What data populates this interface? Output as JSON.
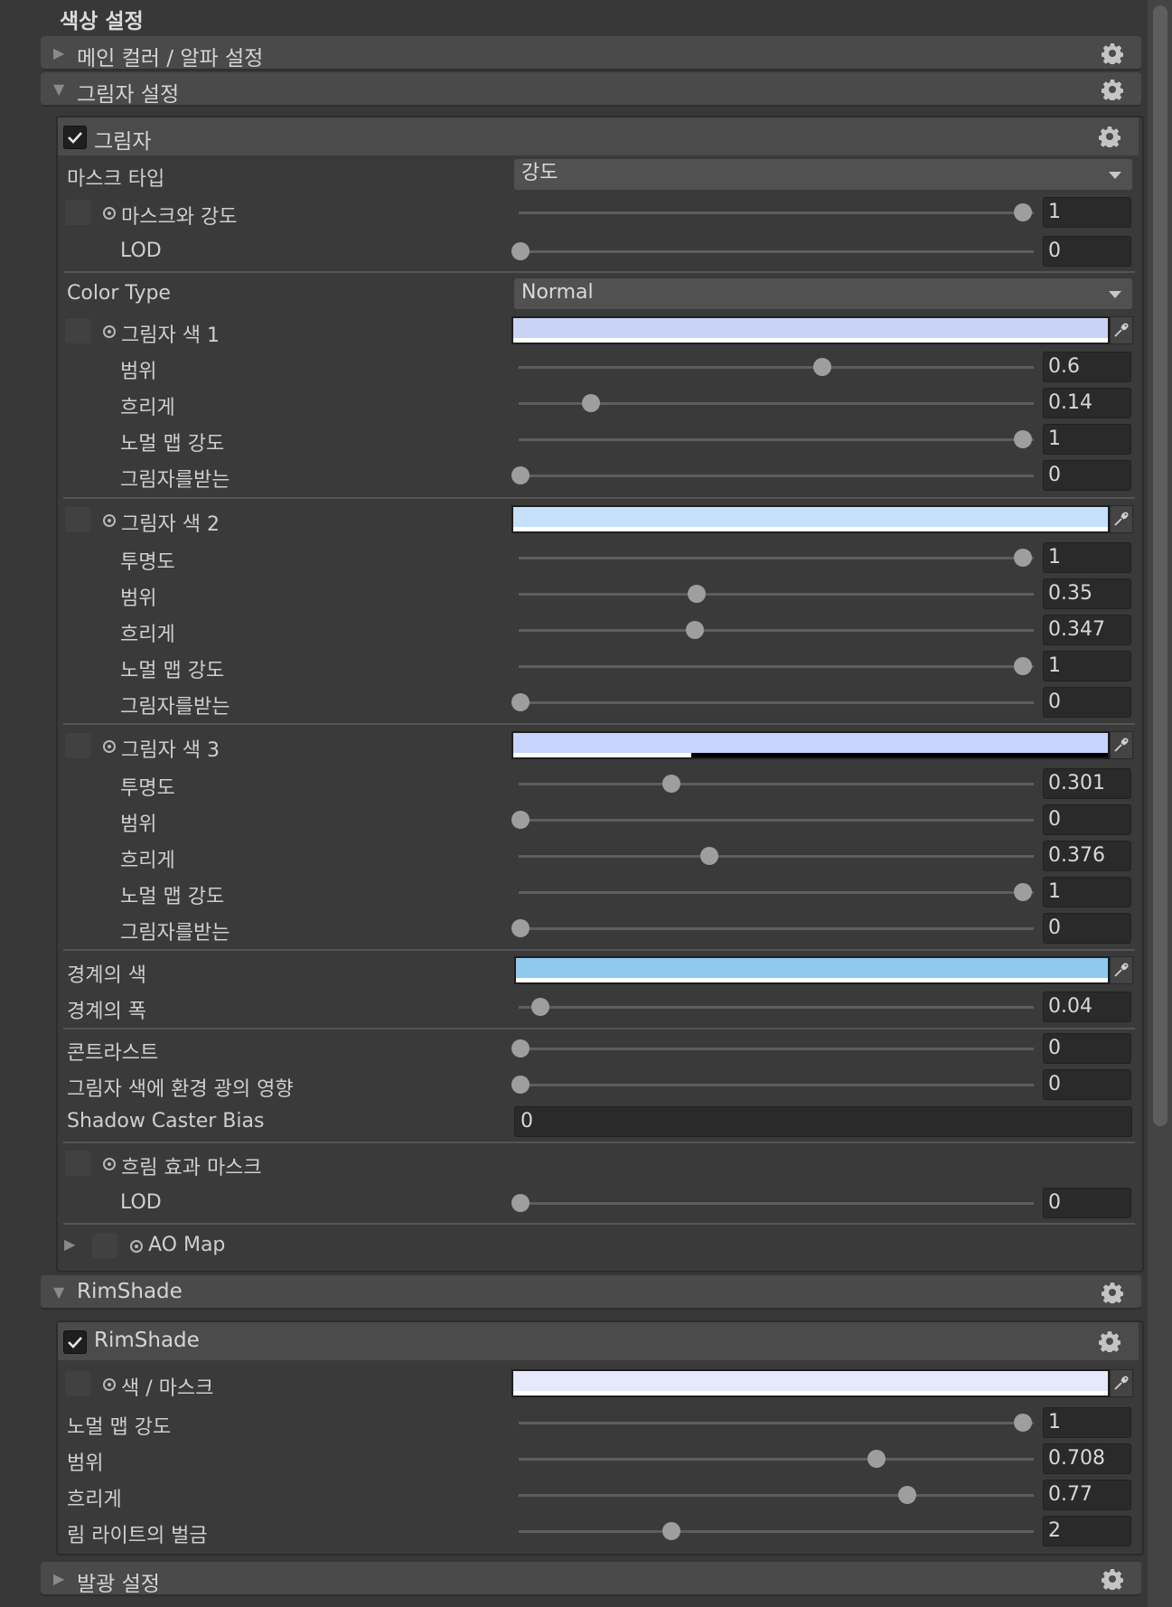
{
  "title": "색상 설정",
  "sections": {
    "main_color": "메인 컬러 / 알파 설정",
    "shadow_settings": "그림자 설정",
    "rimshade_section": "RimShade",
    "emission": "발광 설정"
  },
  "shadow": {
    "header": "그림자",
    "mask_type_label": "마스크 타입",
    "mask_type_value": "강도",
    "mask_strength_label": "마스크와 강도",
    "mask_strength_value": "1",
    "mask_lod_label": "LOD",
    "mask_lod_value": "0",
    "color_type_label": "Color Type",
    "color_type_value": "Normal",
    "color1_label": "그림자 색 1",
    "color1_hex": "#c9d3f6",
    "c1_range_label": "범위",
    "c1_range_value": "0.6",
    "c1_blur_label": "흐리게",
    "c1_blur_value": "0.14",
    "c1_normal_label": "노멀 맵 강도",
    "c1_normal_value": "1",
    "c1_receive_label": "그림자를받는",
    "c1_receive_value": "0",
    "color2_label": "그림자 색 2",
    "color2_hex": "#c5e0fb",
    "c2_opacity_label": "투명도",
    "c2_opacity_value": "1",
    "c2_range_label": "범위",
    "c2_range_value": "0.35",
    "c2_blur_label": "흐리게",
    "c2_blur_value": "0.347",
    "c2_normal_label": "노멀 맵 강도",
    "c2_normal_value": "1",
    "c2_receive_label": "그림자를받는",
    "c2_receive_value": "0",
    "color3_label": "그림자 색 3",
    "color3_hex": "#c7d4fc",
    "c3_opacity_label": "투명도",
    "c3_opacity_value": "0.301",
    "c3_range_label": "범위",
    "c3_range_value": "0",
    "c3_blur_label": "흐리게",
    "c3_blur_value": "0.376",
    "c3_normal_label": "노멀 맵 강도",
    "c3_normal_value": "1",
    "c3_receive_label": "그림자를받는",
    "c3_receive_value": "0",
    "border_color_label": "경계의 색",
    "border_color_hex": "#8fcaee",
    "border_width_label": "경계의 폭",
    "border_width_value": "0.04",
    "contrast_label": "콘트라스트",
    "contrast_value": "0",
    "env_light_label": "그림자 색에 환경 광의 영향",
    "env_light_value": "0",
    "caster_bias_label": "Shadow Caster Bias",
    "caster_bias_value": "0",
    "blur_mask_label": "흐림 효과 마스크",
    "blur_lod_label": "LOD",
    "blur_lod_value": "0",
    "ao_map_label": "AO Map"
  },
  "rimshade": {
    "header": "RimShade",
    "color_mask_label": "색 / 마스크",
    "color_hex": "#e5e9fb",
    "normal_label": "노멀 맵 강도",
    "normal_value": "1",
    "range_label": "범위",
    "range_value": "0.708",
    "blur_label": "흐리게",
    "blur_value": "0.77",
    "spill_label": "림 라이트의 벌금",
    "spill_value": "2"
  },
  "sliders": {
    "mask_strength": 1.0,
    "mask_lod": 0.0,
    "c1_range": 0.6,
    "c1_blur": 0.14,
    "c1_normal": 1.0,
    "c1_receive": 0.0,
    "c2_opacity": 1.0,
    "c2_range": 0.35,
    "c2_blur": 0.347,
    "c2_normal": 1.0,
    "c2_receive": 0.0,
    "c3_opacity": 0.301,
    "c3_range": 0.0,
    "c3_blur": 0.376,
    "c3_normal": 1.0,
    "c3_receive": 0.0,
    "border_width": 0.04,
    "contrast": 0.0,
    "env_light": 0.0,
    "blur_lod": 0.0,
    "rim_normal": 1.0,
    "rim_range": 0.708,
    "rim_blur": 0.77,
    "rim_spill": 0.3
  },
  "swatch_alpha": {
    "color1": 1.0,
    "color2": 1.0,
    "color3": 0.3,
    "border": 1.0,
    "rim": 1.0
  },
  "icons": {
    "gear": "gear-icon",
    "picker": "eyedropper-icon",
    "expand": "triangle-right-icon",
    "collapse": "triangle-down-icon",
    "check": "checkmark-icon"
  }
}
